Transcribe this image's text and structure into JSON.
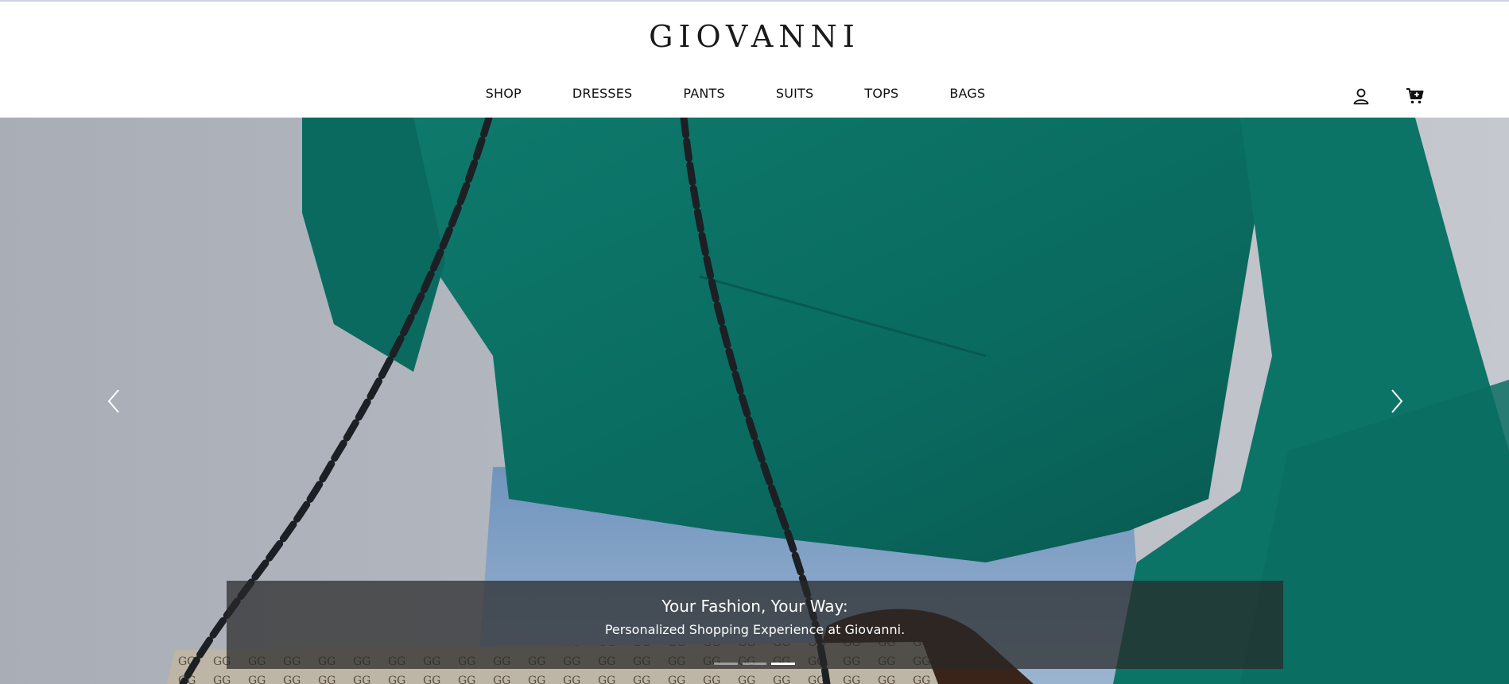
{
  "brand": {
    "logo": "GIOVANNI"
  },
  "nav": {
    "items": [
      {
        "label": "SHOP"
      },
      {
        "label": "DRESSES"
      },
      {
        "label": "PANTS"
      },
      {
        "label": "SUITS"
      },
      {
        "label": "TOPS"
      },
      {
        "label": "BAGS"
      }
    ],
    "icons": [
      "user-icon",
      "cart-icon"
    ]
  },
  "carousel": {
    "caption": {
      "title": "Your Fashion, Your Way:",
      "subtitle": "Personalized Shopping Experience at Giovanni."
    },
    "slide_count": 3,
    "active_slide": 3,
    "controls": [
      "chevron-left-icon",
      "chevron-right-icon"
    ]
  },
  "colors": {
    "accent": "#1a1a1a",
    "jacket_green": "#0b6f63",
    "denim": "#7a9cc2",
    "backdrop": "#b8bcc4",
    "caption_bg": "#3a3a3a"
  }
}
